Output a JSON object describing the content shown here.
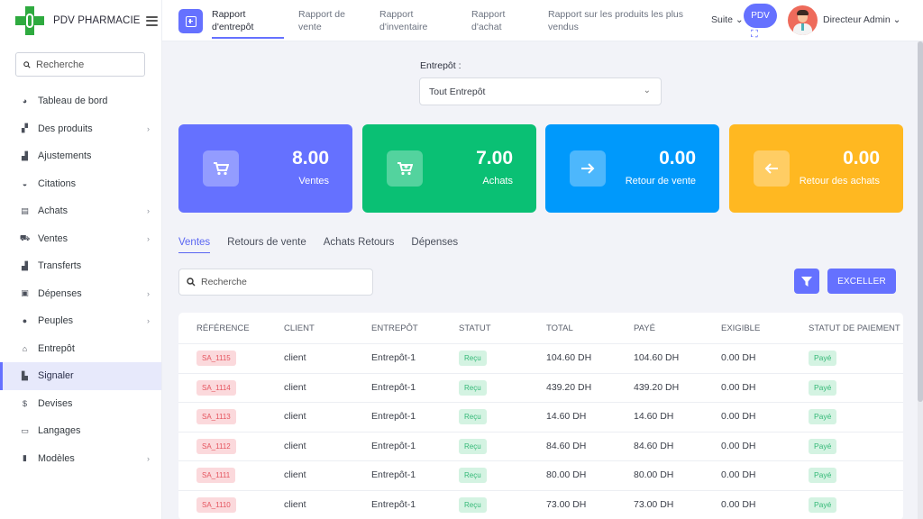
{
  "brand": {
    "name": "PDV PHARMACIE"
  },
  "sidebar": {
    "search_placeholder": "Recherche",
    "items": [
      {
        "label": "Tableau de bord",
        "icon": "chart-pie-icon",
        "chev": false
      },
      {
        "label": "Des produits",
        "icon": "boxes-icon",
        "chev": true
      },
      {
        "label": "Ajustements",
        "icon": "industry-icon",
        "chev": false
      },
      {
        "label": "Citations",
        "icon": "basket-icon",
        "chev": false
      },
      {
        "label": "Achats",
        "icon": "receipt-icon",
        "chev": true
      },
      {
        "label": "Ventes",
        "icon": "cart-icon",
        "chev": true
      },
      {
        "label": "Transferts",
        "icon": "truck-icon",
        "chev": false
      },
      {
        "label": "Dépenses",
        "icon": "money-icon",
        "chev": true
      },
      {
        "label": "Peuples",
        "icon": "user-icon",
        "chev": true
      },
      {
        "label": "Entrepôt",
        "icon": "home-icon",
        "chev": false
      },
      {
        "label": "Signaler",
        "icon": "bar-chart-icon",
        "chev": false,
        "active": true
      },
      {
        "label": "Devises",
        "icon": "dollar-icon",
        "chev": false
      },
      {
        "label": "Langages",
        "icon": "language-icon",
        "chev": false
      },
      {
        "label": "Modèles",
        "icon": "file-icon",
        "chev": true
      }
    ]
  },
  "topbar": {
    "tabs": [
      {
        "label": "Rapport d'entrepôt",
        "active": true
      },
      {
        "label": "Rapport de vente"
      },
      {
        "label": "Rapport d'inventaire"
      },
      {
        "label": "Rapport d'achat"
      },
      {
        "label": "Rapport sur les produits les plus vendus"
      }
    ],
    "more": "Suite",
    "pdv": "PDV",
    "user": "Directeur Admin"
  },
  "filter": {
    "label": "Entrepôt :",
    "selected": "Tout Entrepôt"
  },
  "cards": [
    {
      "value": "8.00",
      "label": "Ventes",
      "color": "#6571ff",
      "icon": "cart-icon"
    },
    {
      "value": "7.00",
      "label": "Achats",
      "color": "#0ac074",
      "icon": "cart-plus-icon"
    },
    {
      "value": "0.00",
      "label": "Retour de vente",
      "color": "#0099fb",
      "icon": "arrow-right-icon"
    },
    {
      "value": "0.00",
      "label": "Retour des achats",
      "color": "#ffb821",
      "icon": "arrow-left-icon"
    }
  ],
  "report_tabs": [
    "Ventes",
    "Retours de vente",
    "Achats Retours",
    "Dépenses"
  ],
  "table": {
    "search_placeholder": "Recherche",
    "export_label": "EXCELLER",
    "headers": [
      "RÉFÉRENCE",
      "CLIENT",
      "ENTREPÔT",
      "STATUT",
      "TOTAL",
      "PAYÉ",
      "EXIGIBLE",
      "STATUT DE PAIEMENT"
    ],
    "rows": [
      {
        "ref": "SA_1115",
        "client": "client",
        "warehouse": "Entrepôt-1",
        "status": "Reçu",
        "total": "104.60 DH",
        "paid": "104.60 DH",
        "due": "0.00 DH",
        "payment": "Payé"
      },
      {
        "ref": "SA_1114",
        "client": "client",
        "warehouse": "Entrepôt-1",
        "status": "Reçu",
        "total": "439.20 DH",
        "paid": "439.20 DH",
        "due": "0.00 DH",
        "payment": "Payé"
      },
      {
        "ref": "SA_1113",
        "client": "client",
        "warehouse": "Entrepôt-1",
        "status": "Reçu",
        "total": "14.60 DH",
        "paid": "14.60 DH",
        "due": "0.00 DH",
        "payment": "Payé"
      },
      {
        "ref": "SA_1112",
        "client": "client",
        "warehouse": "Entrepôt-1",
        "status": "Reçu",
        "total": "84.60 DH",
        "paid": "84.60 DH",
        "due": "0.00 DH",
        "payment": "Payé"
      },
      {
        "ref": "SA_1111",
        "client": "client",
        "warehouse": "Entrepôt-1",
        "status": "Reçu",
        "total": "80.00 DH",
        "paid": "80.00 DH",
        "due": "0.00 DH",
        "payment": "Payé"
      },
      {
        "ref": "SA_1110",
        "client": "client",
        "warehouse": "Entrepôt-1",
        "status": "Reçu",
        "total": "73.00 DH",
        "paid": "73.00 DH",
        "due": "0.00 DH",
        "payment": "Payé"
      }
    ]
  }
}
